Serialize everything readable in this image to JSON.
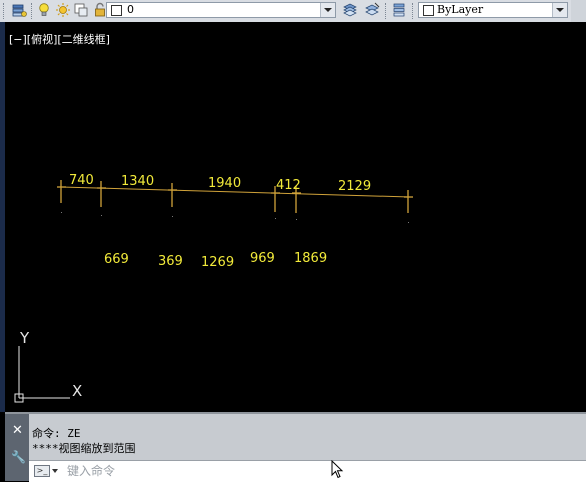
{
  "toolbar": {
    "layer_name": "0",
    "color_value": "ByLayer",
    "icons": [
      "layer-manager-icon",
      "lightbulb-icon",
      "sun-icon",
      "freeze-icon",
      "lock-icon",
      "color-swatch-icon",
      "layer-state-icon",
      "match-layer-icon",
      "layer-previous-icon"
    ]
  },
  "viewport": {
    "label": "[−][俯视][二维线框]",
    "top_labels": [
      "740",
      "1340",
      "1940",
      "412",
      "2129"
    ],
    "bottom_labels": [
      "669",
      "369",
      "1269",
      "969",
      "1869"
    ],
    "ucs": {
      "y": "Y",
      "x": "X"
    }
  },
  "command_line": {
    "history": [
      "命令: ZE",
      "****视图缩放到范围"
    ],
    "placeholder": "键入命令"
  },
  "colors": {
    "annotation": "#f2ea3a",
    "line": "#d1a33a",
    "background": "#000000",
    "toolbar": "#d9dde3"
  }
}
